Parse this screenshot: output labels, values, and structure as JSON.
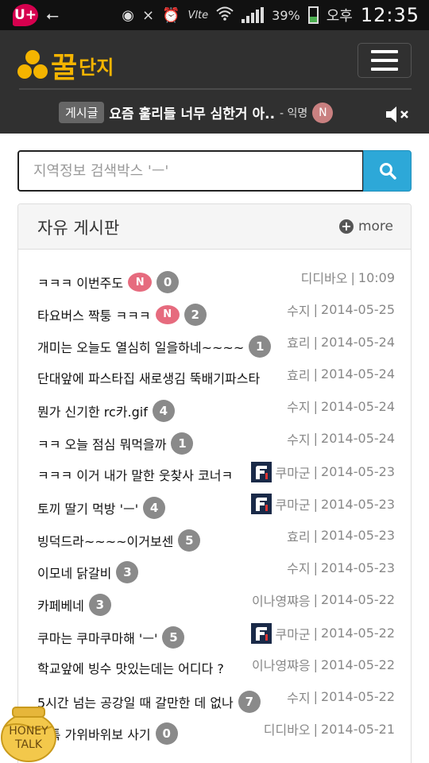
{
  "status_bar": {
    "carrier_icon": "U+",
    "battery": "39%",
    "ampm": "오후",
    "time": "12:35",
    "network": "Vlte",
    "icons": [
      "usb-icon",
      "eye-icon",
      "no-signal-icon",
      "alarm-icon",
      "wifi-icon",
      "signal-icon",
      "battery-icon"
    ]
  },
  "header": {
    "logo_main": "꿀",
    "logo_sub": "단지",
    "ticker": {
      "category": "게시글",
      "title": "요즘 훌리들 너무 심한거 아..",
      "author": "- 익명",
      "new_badge": "N"
    }
  },
  "search": {
    "placeholder": "지역정보 검색박스 'ㅡ'"
  },
  "board": {
    "title": "자유 게시판",
    "more_label": "more",
    "posts": [
      {
        "title": "ㅋㅋㅋ 이번주도",
        "new": "N",
        "count": "0",
        "author": "디디바오",
        "date": "10:09"
      },
      {
        "title": "타요버스 짝퉁 ㅋㅋㅋ",
        "new": "N",
        "count": "2",
        "author": "수지",
        "date": "2014-05-25"
      },
      {
        "title": "개미는 오늘도 열심히 일을하네~~~~",
        "count": "1",
        "author": "효리",
        "date": "2014-05-24"
      },
      {
        "title": "단대앞에 파스타집 새로생김 뚝배기파스타",
        "author": "효리",
        "date": "2014-05-24"
      },
      {
        "title": "뭔가 신기한 rc카.gif",
        "count": "4",
        "author": "수지",
        "date": "2014-05-24"
      },
      {
        "title": "ㅋㅋ 오늘 점심 뭐먹을까",
        "count": "1",
        "author": "수지",
        "date": "2014-05-24"
      },
      {
        "title": "ㅋㅋㅋ 이거 내가 말한 웃찾사 코너ㅋ",
        "author": "쿠마군",
        "date": "2014-05-23",
        "avatar": true
      },
      {
        "title": "토끼 딸기 먹방 'ㅡ'",
        "count": "4",
        "author": "쿠마군",
        "date": "2014-05-23",
        "avatar": true
      },
      {
        "title": "빙덕드라~~~~이거보센",
        "count": "5",
        "author": "효리",
        "date": "2014-05-23"
      },
      {
        "title": "이모네 닭갈비",
        "count": "3",
        "author": "수지",
        "date": "2014-05-23"
      },
      {
        "title": "카페베네",
        "count": "3",
        "author": "이나영쨔응",
        "date": "2014-05-22"
      },
      {
        "title": "쿠마는 쿠마쿠마해 'ㅡ'",
        "count": "5",
        "author": "쿠마군",
        "date": "2014-05-22",
        "avatar": true
      },
      {
        "title": "학교앞에 빙수 맛있는데는 어디다 ?",
        "author": "이나영쨔응",
        "date": "2014-05-22"
      },
      {
        "title": "5시간 넘는 공강일 때 갈만한 데 없나",
        "count": "7",
        "author": "수지",
        "date": "2014-05-22"
      },
      {
        "title": "꿀톡 가위바위보 사기",
        "count": "0",
        "author": "디디바오",
        "date": "2014-05-21"
      }
    ]
  },
  "honey_talk": {
    "line1": "HONEY",
    "line2": "TALK"
  },
  "colors": {
    "header_bg": "#303030",
    "brand_gold": "#f4b400",
    "search_button": "#2da8d8",
    "new_badge": "#e66b7e",
    "count_badge": "#8a8a8a"
  }
}
